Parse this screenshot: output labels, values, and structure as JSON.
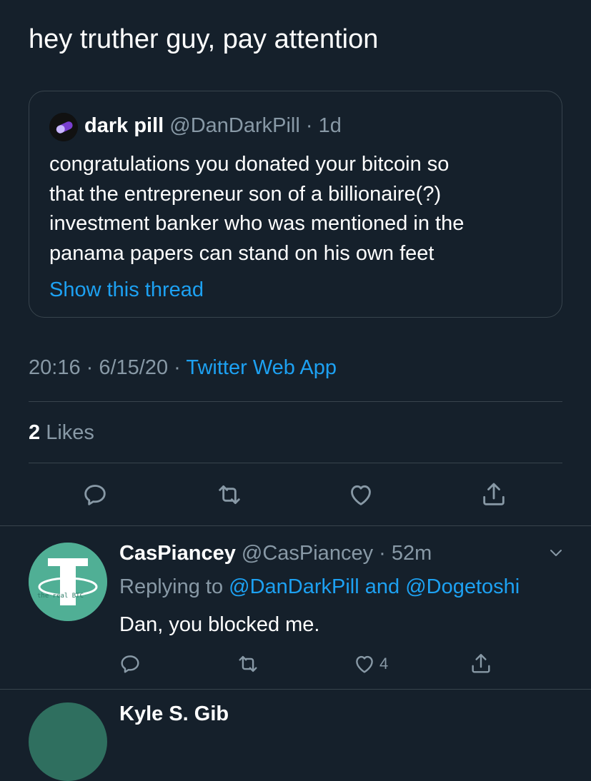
{
  "tweet": {
    "text": "hey truther guy, pay attention",
    "timestamp": "20:16 · 6/15/20 ·",
    "source": "Twitter Web App",
    "likes_count": "2",
    "likes_label": "Likes"
  },
  "quote": {
    "name": "dark pill",
    "handle": "@DanDarkPill",
    "age": "· 1d",
    "lines": [
      "congratulations you donated your bitcoin so",
      "that the entrepreneur son of a billionaire(?)",
      "investment banker who was mentioned in the",
      "panama papers can stand on his own feet"
    ],
    "show_thread": "Show this thread"
  },
  "actions": {
    "reply_icon": "reply-icon",
    "retweet_icon": "retweet-icon",
    "like_icon": "heart-icon",
    "share_icon": "share-icon"
  },
  "reply": {
    "name": "CasPiancey",
    "handle": "@CasPiancey",
    "age": "· 52m",
    "replying_prefix": "Replying to",
    "replying_users": "@DanDarkPill and @Dogetoshi",
    "text": "Dan, you blocked me.",
    "like_count": "4",
    "avatar_text": "the real BTC"
  },
  "next_reply": {
    "name_partial": "Kyle S. Gib"
  },
  "colors": {
    "background": "#15202b",
    "accent": "#1da1f2",
    "muted": "#8899a6",
    "divider": "#38444d"
  }
}
